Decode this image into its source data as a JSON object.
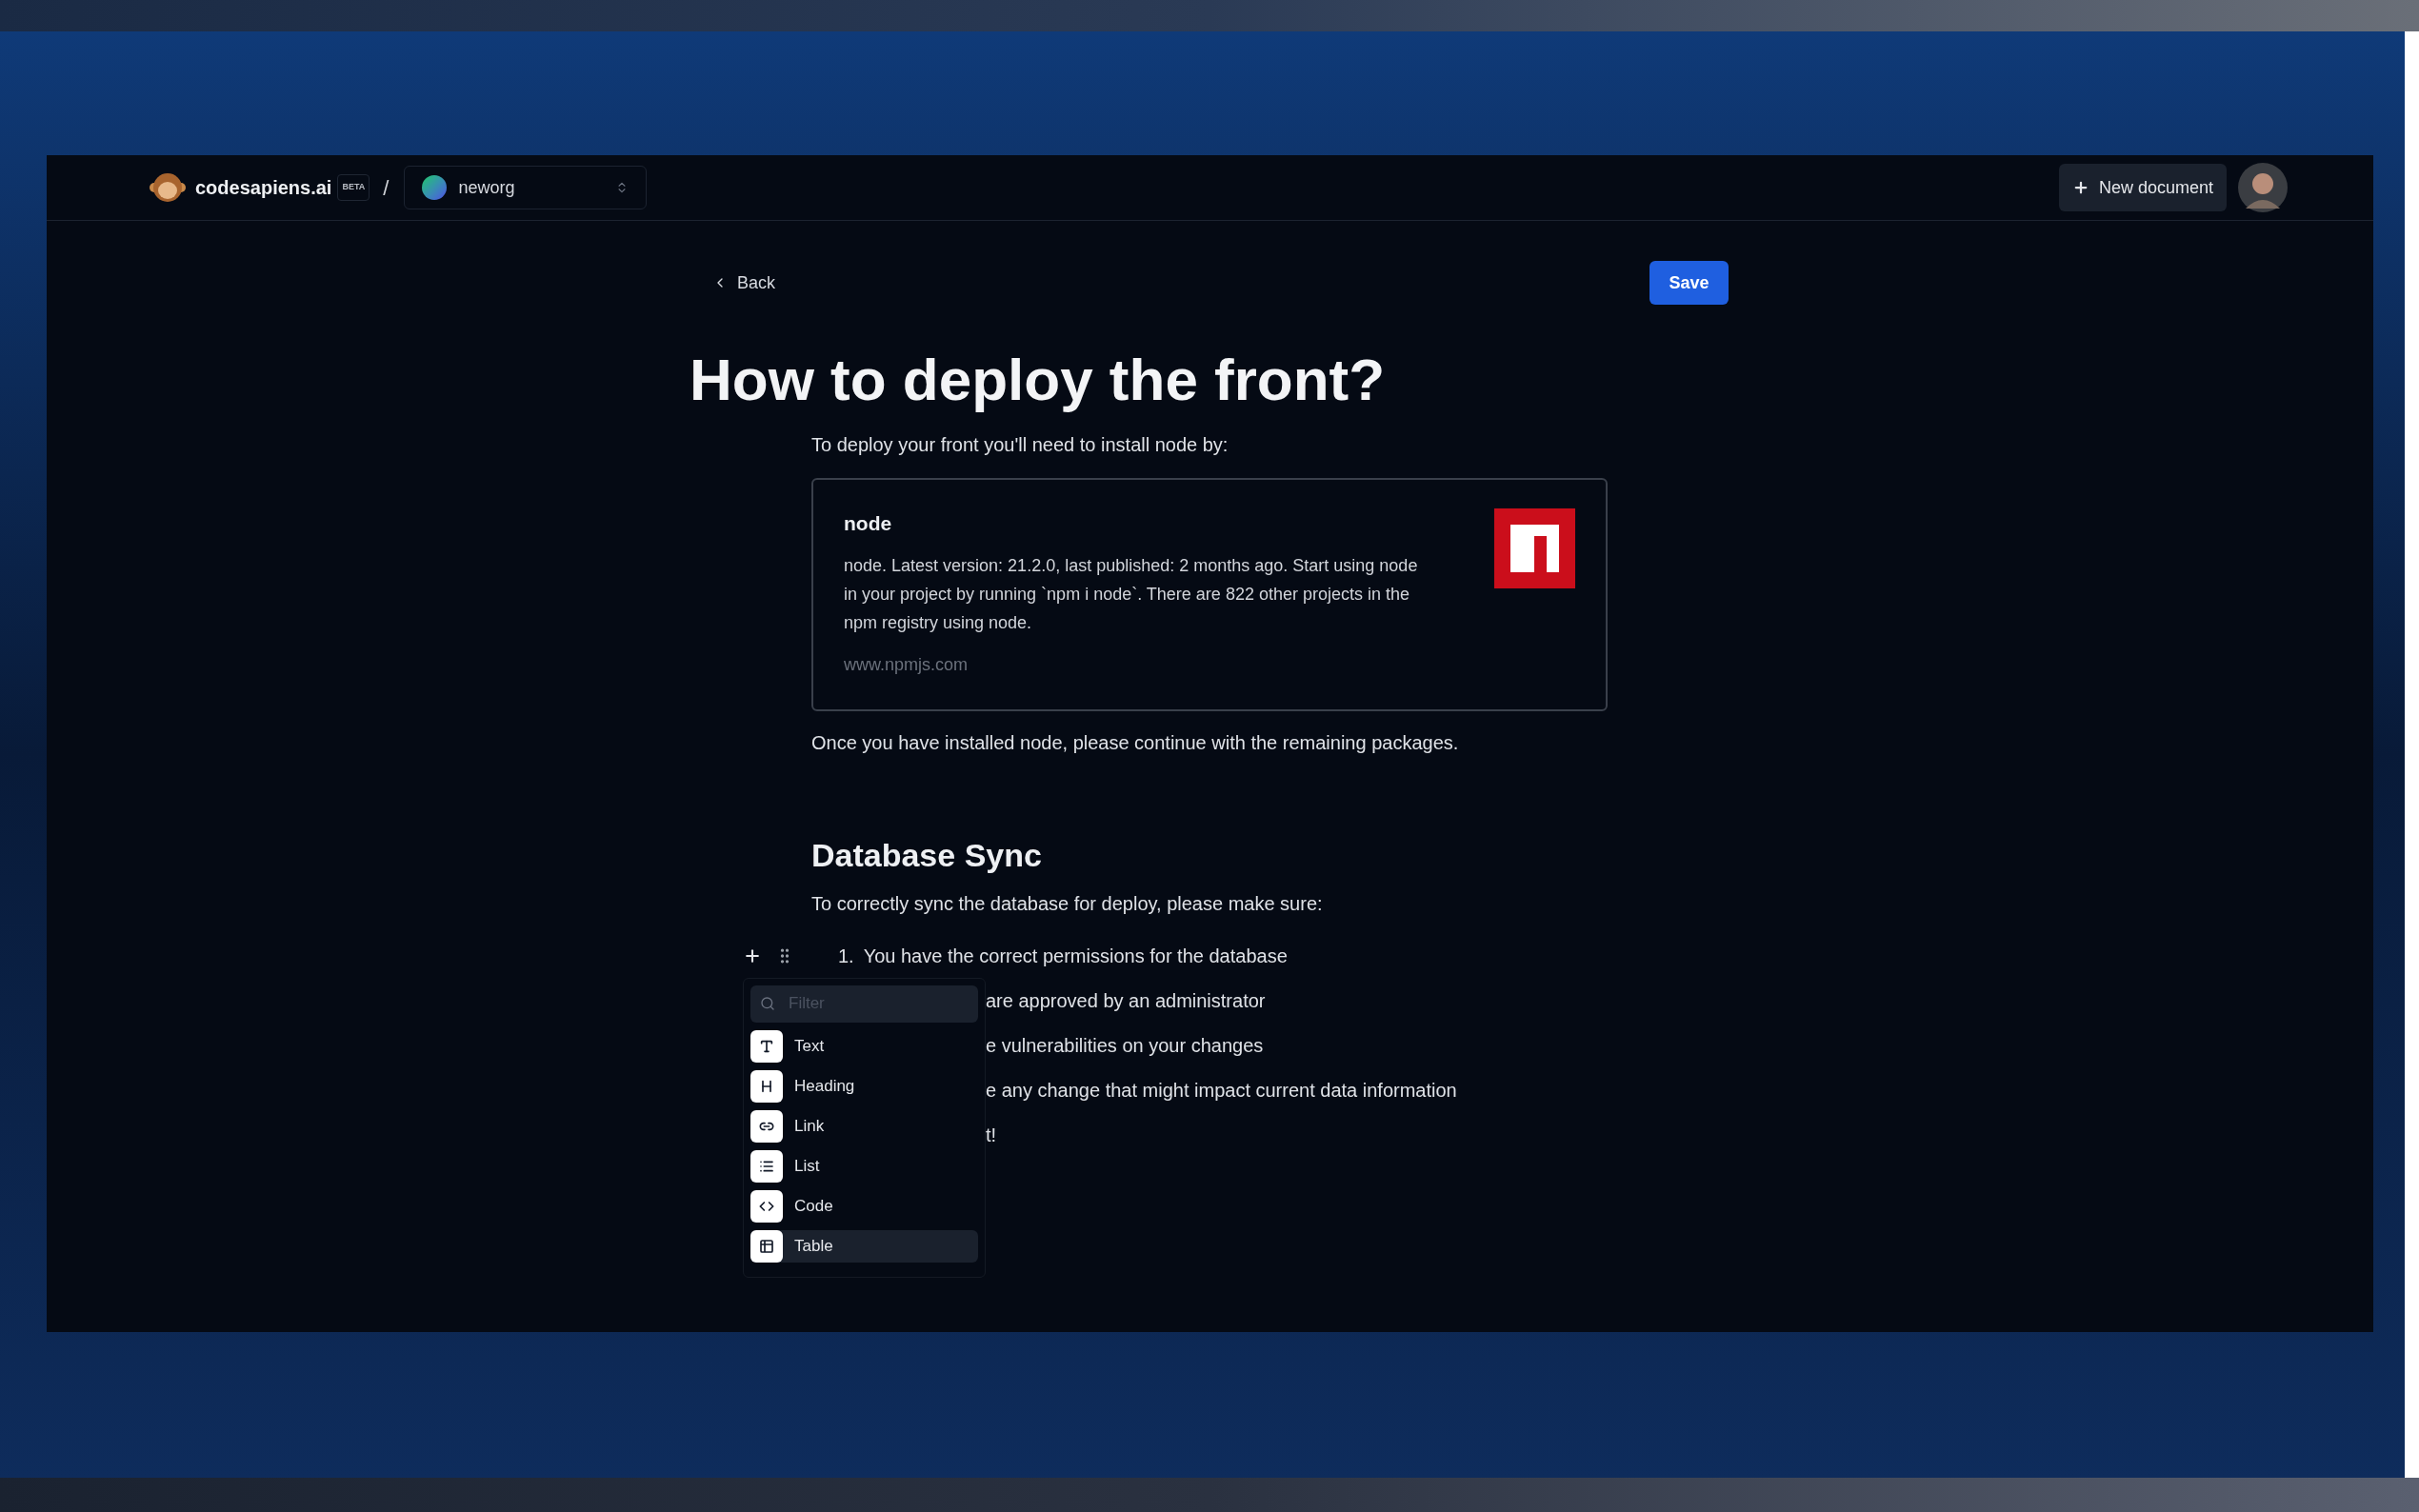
{
  "header": {
    "brand": "codesapiens.ai",
    "badge": "BETA",
    "separator": "/",
    "org": "neworg",
    "new_document": "New document"
  },
  "toolbar": {
    "back": "Back",
    "save": "Save"
  },
  "document": {
    "title": "How to deploy the front?",
    "intro": "To deploy your front you'll need to install node by:",
    "embed": {
      "title": "node",
      "description": "node. Latest version: 21.2.0, last published: 2 months ago. Start using node in your project by running `npm i node`. There are 822 other projects in the npm registry using node.",
      "url": "www.npmjs.com"
    },
    "after_embed": "Once you have installed node, please continue with the remaining packages.",
    "section_heading": "Database Sync",
    "section_intro": "To correctly sync the database for deploy, please make sure:",
    "list": [
      {
        "number": "1.",
        "text": "You have the correct permissions for the database"
      },
      {
        "text": "are approved by an administrator"
      },
      {
        "text": "e vulnerabilities on your changes"
      },
      {
        "text": "e any change that might impact current data information"
      },
      {
        "text": "t!"
      }
    ]
  },
  "block_menu": {
    "filter_placeholder": "Filter",
    "items": [
      {
        "kind": "text",
        "label": "Text",
        "selected": false
      },
      {
        "kind": "heading",
        "label": "Heading",
        "selected": false
      },
      {
        "kind": "link",
        "label": "Link",
        "selected": false
      },
      {
        "kind": "list",
        "label": "List",
        "selected": false
      },
      {
        "kind": "code",
        "label": "Code",
        "selected": false
      },
      {
        "kind": "table",
        "label": "Table",
        "selected": true
      }
    ]
  }
}
